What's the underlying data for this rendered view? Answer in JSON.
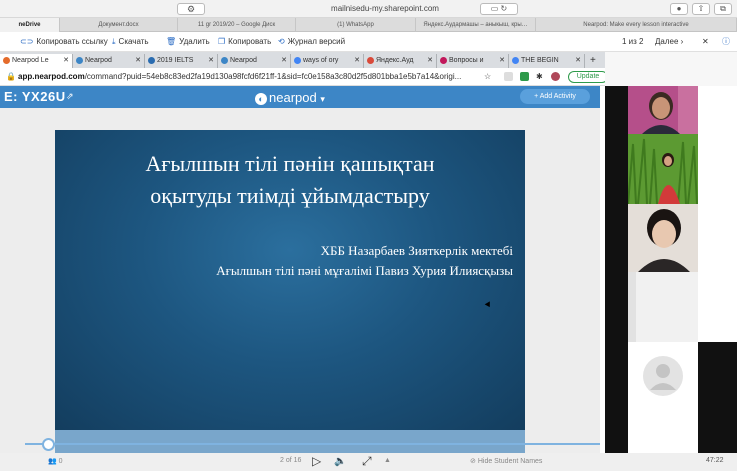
{
  "browser": {
    "url": "mailnisedu-my.sharepoint.com"
  },
  "doc_tabs": [
    {
      "label": "neDrive",
      "active": true
    },
    {
      "label": "Документ.docx",
      "active": false
    },
    {
      "label": "11 gr 2019/20 – Google Диск",
      "active": false
    },
    {
      "label": "(1) WhatsApp",
      "active": false
    },
    {
      "label": "Яндекс.Аудармашы – аныкыш, кры…",
      "active": false
    },
    {
      "label": "Nearpod: Make every lesson interactive",
      "active": false
    }
  ],
  "onedrive_toolbar": {
    "copy_link": "Копировать ссылку",
    "download": "Скачать",
    "delete": "Удалить",
    "copy": "Копировать",
    "versions": "Журнал версий",
    "pager": "1 из 2",
    "next": "Далее"
  },
  "chrome_tabs": [
    {
      "label": "Nearpod Le",
      "active": true,
      "color": "#e46b2b"
    },
    {
      "label": "Nearpod",
      "active": false,
      "color": "#3d86c6"
    },
    {
      "label": "2019 IELTS",
      "active": false,
      "color": "#2a6cb0"
    },
    {
      "label": "Nearpod",
      "active": false,
      "color": "#3d86c6"
    },
    {
      "label": "ways of ory",
      "active": false,
      "color": "#4285f4"
    },
    {
      "label": "Яндекс.Ауд",
      "active": false,
      "color": "#d94a3a"
    },
    {
      "label": "Вопросы и",
      "active": false,
      "color": "#c2185b"
    },
    {
      "label": "THE BEGIN",
      "active": false,
      "color": "#4285f4"
    }
  ],
  "address": {
    "host": "app.nearpod.com",
    "path": "/command?puid=54eb8c83ed2fa19d130a98fcfd6f21ff-1&sid=fc0e158a3c80d2f5d801bba1e5b7a14&origi...",
    "update_label": "Update"
  },
  "nearpod": {
    "code_prefix": "E:",
    "code": "YX26U",
    "logo": "nearpod",
    "add_activity": "+ Add Activity"
  },
  "slide": {
    "title_line1": "Ағылшын тілі пәнін қашықтан",
    "title_line2": "оқытуды тиімді ұйымдастыру",
    "subtitle1": "ХББ Назарбаев Зияткерлік мектебі",
    "subtitle2": "Ағылшын тілі пәні мұғалімі Павиз Хурия Илиясқызы"
  },
  "player": {
    "students": "0",
    "slide_counter": "2 of 16",
    "hide_names": "Hide Student Names",
    "time": "47:22",
    "progress": 0.04
  },
  "colors": {
    "nearpod_blue": "#3d86c6",
    "slide_bg": "#1d5680",
    "update_green": "#2e9a4a"
  }
}
